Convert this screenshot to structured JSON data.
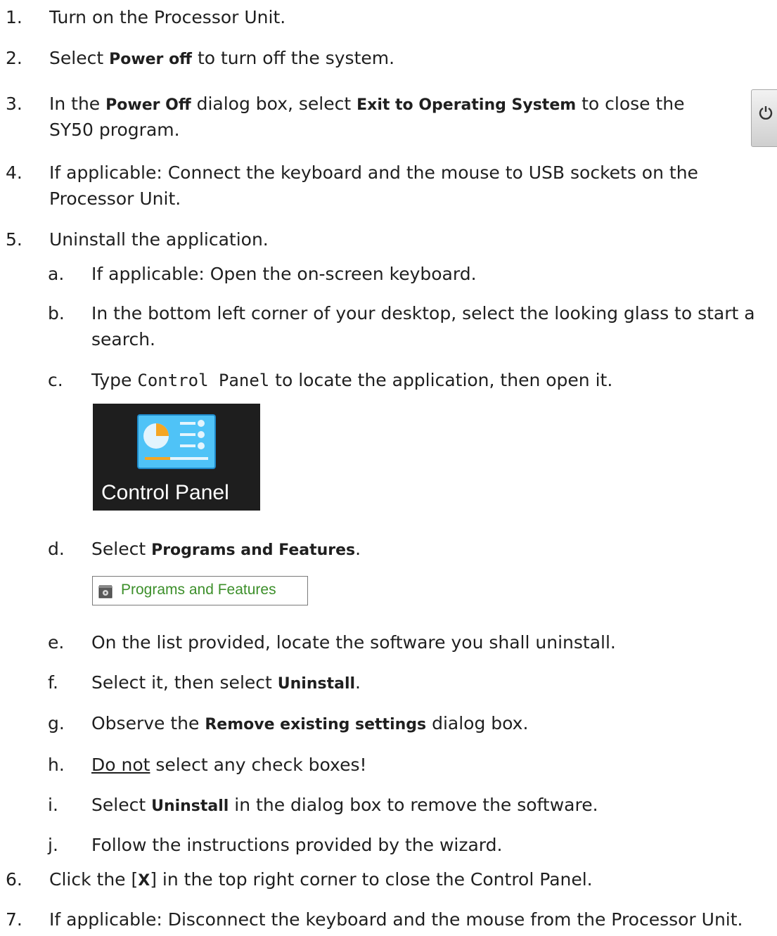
{
  "steps": [
    {
      "num": "1.",
      "text": "Turn on the Processor Unit."
    },
    {
      "num": "2.",
      "pre": "Select ",
      "bold": "Power off",
      "post": " to turn off the system."
    },
    {
      "num": "3.",
      "pre": "In the ",
      "bold": "Power Off",
      "mid": " dialog box, select ",
      "bold2": "Exit to Operating System",
      "post": " to close the",
      "line2": "SY50 program."
    },
    {
      "num": "4.",
      "text": "If applicable: Connect the keyboard and the mouse to USB sockets on the",
      "line2": "Processor Unit."
    },
    {
      "num": "5.",
      "text": "Uninstall the application."
    },
    {
      "num": "6.",
      "pre": "Click the [",
      "bold": "X",
      "post": "] in the top right corner to close the Control Panel."
    },
    {
      "num": "7.",
      "text": "If applicable: Disconnect the keyboard and the mouse from the Processor Unit."
    }
  ],
  "substeps": [
    {
      "num": "a.",
      "text": "If applicable: Open the on-screen keyboard."
    },
    {
      "num": "b.",
      "text": "In the bottom left corner of your desktop, select the looking glass to start a",
      "line2": "search."
    },
    {
      "num": "c.",
      "pre": "Type ",
      "code": "Control Panel",
      "post": " to locate the application, then open it."
    },
    {
      "num": "d.",
      "pre": "Select ",
      "bold": "Programs and Features",
      "post": "."
    },
    {
      "num": "e.",
      "text": "On the list provided, locate the software you shall uninstall."
    },
    {
      "num": "f.",
      "pre": "Select it, then select ",
      "bold": "Uninstall",
      "post": "."
    },
    {
      "num": "g.",
      "pre": "Observe the ",
      "bold": "Remove existing settings",
      "post": " dialog box."
    },
    {
      "num": "h.",
      "underline": "Do not",
      "post": " select any check boxes!"
    },
    {
      "num": "i.",
      "pre": "Select ",
      "bold": "Uninstall",
      "post": " in the dialog box to remove the software."
    },
    {
      "num": "j.",
      "text": "Follow the instructions provided by the wizard."
    }
  ],
  "control_panel_tile": {
    "label": "Control Panel"
  },
  "programs_button": {
    "label": "Programs and Features"
  },
  "icons": {
    "power": "power-icon",
    "control_panel": "control-panel-icon",
    "programs": "programs-features-icon"
  },
  "colors": {
    "programs_label": "#3c8f2a",
    "tile_bg": "#1e1e1e",
    "icon_blue": "#4fc3f7"
  }
}
